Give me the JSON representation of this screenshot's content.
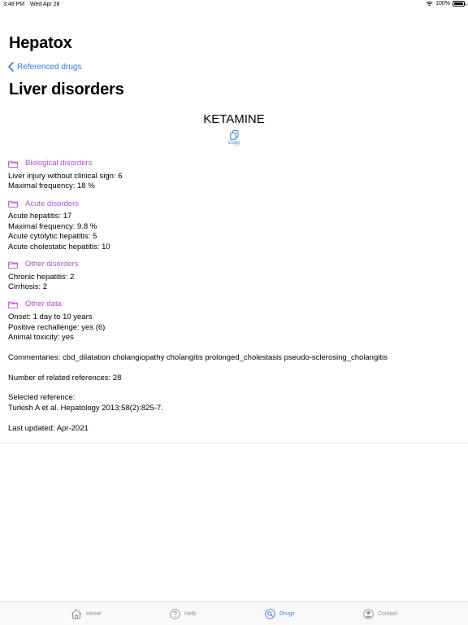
{
  "status_bar": {
    "time": "3:48 PM",
    "date": "Wed Apr 28",
    "battery": "100%"
  },
  "header": {
    "app_title": "Hepatox",
    "back_label": "Referenced drugs",
    "page_title": "Liver disorders"
  },
  "drug": {
    "name": "KETAMINE",
    "copy_label": "Copy"
  },
  "sections": {
    "biological": {
      "title": "Biological disorders",
      "lines": [
        "Liver injury without clinical sign: 6",
        "Maximal frequency: 18 %"
      ]
    },
    "acute": {
      "title": "Acute disorders",
      "lines": [
        "Acute hepatitis: 17",
        "Maximal frequency: 9.8 %",
        "Acute cytolytic hepatitis: 5",
        "Acute cholestatic hepatitis: 10"
      ]
    },
    "other": {
      "title": "Other disorders",
      "lines": [
        "Chronic hepatitis: 2",
        "Cirrhosis: 2"
      ]
    },
    "other_data": {
      "title": "Other data",
      "lines": [
        "Onset: 1 day to 10 years",
        "Positive rechallenge: yes (6)",
        "Animal toxicity: yes"
      ]
    }
  },
  "commentaries": "Commentaries: cbd_dilatation cholangiopathy cholangitis prolonged_cholestasis pseudo-sclerosing_cholangitis",
  "related_refs": "Number of related references: 28",
  "selected_ref": {
    "label": "Selected reference:",
    "value": "Turkish A et al. Hepatology 2013;58(2):825-7."
  },
  "last_updated": "Last updated: Apr-2021",
  "tabs": [
    {
      "label": "Home",
      "icon": "house-icon"
    },
    {
      "label": "Help",
      "icon": "question-circle-icon"
    },
    {
      "label": "Drugs",
      "icon": "magnifier-circle-icon",
      "active": true
    },
    {
      "label": "Contact",
      "icon": "person-circle-icon"
    }
  ],
  "colors": {
    "accent": "#2f7de1",
    "section_heading": "#b44fcf",
    "inactive_tab": "#8e8e93"
  }
}
